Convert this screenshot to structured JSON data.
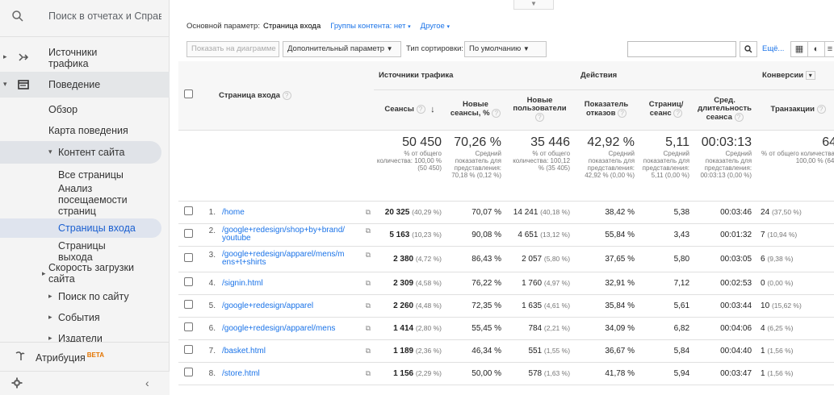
{
  "sidebar": {
    "search_placeholder": "Поиск в отчетах и Справке",
    "traffic_sources": "Источники трафика",
    "behavior": "Поведение",
    "overview": "Обзор",
    "behavior_flow": "Карта поведения",
    "site_content": "Контент сайта",
    "all_pages": "Все страницы",
    "content_drilldown": "Анализ посещаемости страниц",
    "landing_pages": "Страницы входа",
    "exit_pages": "Страницы выхода",
    "site_speed": "Скорость загрузки сайта",
    "site_search": "Поиск по сайту",
    "events": "События",
    "publisher": "Издатели",
    "attribution": "Атрибуция",
    "attribution_badge": "BETA"
  },
  "header": {
    "primary_dimension_label": "Основной параметр:",
    "primary_dimension_value": "Страница входа",
    "content_groups": "Группы контента: нет",
    "other": "Другое"
  },
  "toolbar": {
    "plot_rows": "Показать на диаграмме",
    "secondary_dimension": "Дополнительный параметр",
    "sort_type_label": "Тип сортировки:",
    "sort_type_value": "По умолчанию",
    "search_value": "",
    "more": "Ещё..."
  },
  "table": {
    "groups": {
      "acquisition": "Источники трафика",
      "behavior": "Действия",
      "conversions": "Конверсии"
    },
    "columns": {
      "landing_page": "Страница входа",
      "sessions": "Сеансы",
      "new_sessions_pct": "Новые сеансы, %",
      "new_users": "Новые пользователи",
      "bounce_rate": "Показатель отказов",
      "pages_per_session": "Страниц/сеанс",
      "avg_duration": "Сред. длительность сеанса",
      "transactions": "Транзакции"
    },
    "totals": {
      "sessions": "50 450",
      "sessions_sub": "% от общего количества: 100,00 % (50 450)",
      "new_sessions_pct": "70,26 %",
      "new_sessions_pct_sub": "Средний показатель для представления: 70,18 % (0,12 %)",
      "new_users": "35 446",
      "new_users_sub": "% от общего количества: 100,12 % (35 405)",
      "bounce_rate": "42,92 %",
      "bounce_rate_sub": "Средний показатель для представления: 42,92 % (0,00 %)",
      "pages_per_session": "5,11",
      "pages_per_session_sub": "Средний показатель для представления: 5,11 (0,00 %)",
      "avg_duration": "00:03:13",
      "avg_duration_sub": "Средний показатель для представления: 00:03:13 (0,00 %)",
      "transactions": "64",
      "transactions_sub": "% от общего количества: 100,00 % (64)"
    },
    "rows": [
      {
        "n": "1.",
        "page": "/home",
        "sessions": "20 325",
        "sessions_pct": "(40,29 %)",
        "new_pct": "70,07 %",
        "new_users": "14 241",
        "new_users_pct": "(40,18 %)",
        "bounce": "38,42 %",
        "pps": "5,38",
        "dur": "00:03:46",
        "tx": "24",
        "tx_pct": "(37,50 %)"
      },
      {
        "n": "2.",
        "page": "/google+redesign/shop+by+brand/youtube",
        "sessions": "5 163",
        "sessions_pct": "(10,23 %)",
        "new_pct": "90,08 %",
        "new_users": "4 651",
        "new_users_pct": "(13,12 %)",
        "bounce": "55,84 %",
        "pps": "3,43",
        "dur": "00:01:32",
        "tx": "7",
        "tx_pct": "(10,94 %)"
      },
      {
        "n": "3.",
        "page": "/google+redesign/apparel/mens/mens+t+shirts",
        "sessions": "2 380",
        "sessions_pct": "(4,72 %)",
        "new_pct": "86,43 %",
        "new_users": "2 057",
        "new_users_pct": "(5,80 %)",
        "bounce": "37,65 %",
        "pps": "5,80",
        "dur": "00:03:05",
        "tx": "6",
        "tx_pct": "(9,38 %)"
      },
      {
        "n": "4.",
        "page": "/signin.html",
        "sessions": "2 309",
        "sessions_pct": "(4,58 %)",
        "new_pct": "76,22 %",
        "new_users": "1 760",
        "new_users_pct": "(4,97 %)",
        "bounce": "32,91 %",
        "pps": "7,12",
        "dur": "00:02:53",
        "tx": "0",
        "tx_pct": "(0,00 %)"
      },
      {
        "n": "5.",
        "page": "/google+redesign/apparel",
        "sessions": "2 260",
        "sessions_pct": "(4,48 %)",
        "new_pct": "72,35 %",
        "new_users": "1 635",
        "new_users_pct": "(4,61 %)",
        "bounce": "35,84 %",
        "pps": "5,61",
        "dur": "00:03:44",
        "tx": "10",
        "tx_pct": "(15,62 %)"
      },
      {
        "n": "6.",
        "page": "/google+redesign/apparel/mens",
        "sessions": "1 414",
        "sessions_pct": "(2,80 %)",
        "new_pct": "55,45 %",
        "new_users": "784",
        "new_users_pct": "(2,21 %)",
        "bounce": "34,09 %",
        "pps": "6,82",
        "dur": "00:04:06",
        "tx": "4",
        "tx_pct": "(6,25 %)"
      },
      {
        "n": "7.",
        "page": "/basket.html",
        "sessions": "1 189",
        "sessions_pct": "(2,36 %)",
        "new_pct": "46,34 %",
        "new_users": "551",
        "new_users_pct": "(1,55 %)",
        "bounce": "36,67 %",
        "pps": "5,84",
        "dur": "00:04:40",
        "tx": "1",
        "tx_pct": "(1,56 %)"
      },
      {
        "n": "8.",
        "page": "/store.html",
        "sessions": "1 156",
        "sessions_pct": "(2,29 %)",
        "new_pct": "50,00 %",
        "new_users": "578",
        "new_users_pct": "(1,63 %)",
        "bounce": "41,78 %",
        "pps": "5,94",
        "dur": "00:03:47",
        "tx": "1",
        "tx_pct": "(1,56 %)"
      }
    ]
  }
}
